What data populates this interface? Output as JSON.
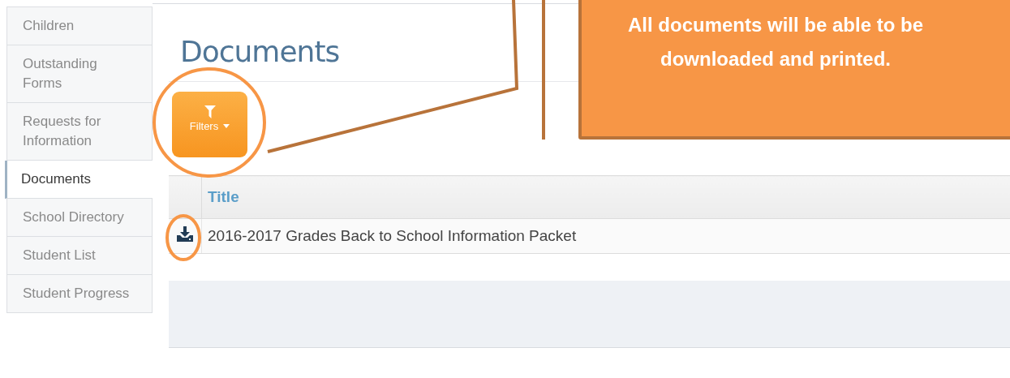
{
  "sidebar": {
    "items": [
      {
        "label": "Children",
        "selected": false
      },
      {
        "label": "Outstanding Forms",
        "selected": false
      },
      {
        "label": "Requests for Information",
        "selected": false
      },
      {
        "label": "Documents",
        "selected": true
      },
      {
        "label": "School Directory",
        "selected": false
      },
      {
        "label": "Student List",
        "selected": false
      },
      {
        "label": "Student Progress",
        "selected": false
      }
    ]
  },
  "page": {
    "title": "Documents",
    "filter_button": {
      "label": "Filters"
    }
  },
  "table": {
    "columns": [
      "Title"
    ],
    "rows": [
      {
        "title": "2016-2017 Grades Back to School Information Packet"
      }
    ]
  },
  "annotation": {
    "text": "All documents will be able to be downloaded and printed."
  }
}
